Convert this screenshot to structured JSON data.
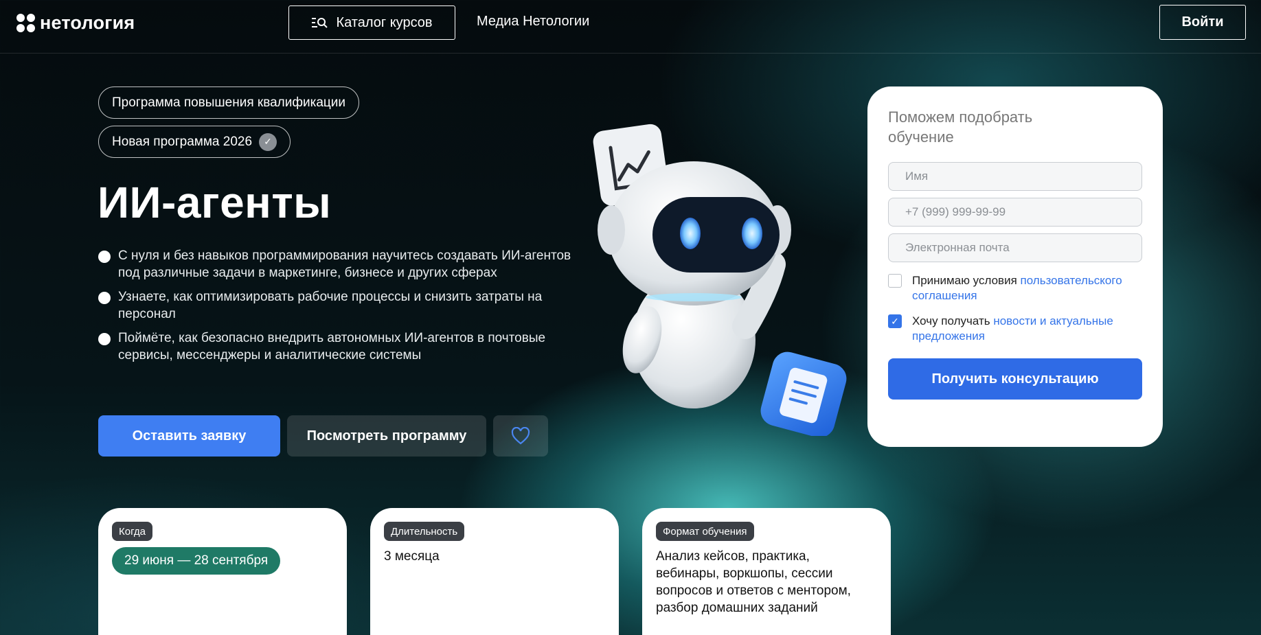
{
  "header": {
    "logo_text": "нетология",
    "catalog_label": "Каталог курсов",
    "media_label": "Медиа Нетологии",
    "login_label": "Войти"
  },
  "hero": {
    "badge_program": "Программа повышения квалификации",
    "badge_new": "Новая программа 2026",
    "title": "ИИ-агенты",
    "bullets": [
      "С нуля и без навыков программирования научитесь создавать ИИ-агентов под различные задачи в маркетинге, бизнесе и других сферах",
      "Узнаете, как оптимизировать рабочие процессы и снизить затраты на персонал",
      "Поймёте, как безопасно внедрить автономных ИИ-агентов в почтовые сервисы, мессенджеры и аналитические системы"
    ],
    "apply_label": "Оставить заявку",
    "program_label": "Посмотреть программу"
  },
  "form": {
    "title": "Поможем подобрать обучение",
    "name_placeholder": "Имя",
    "phone_placeholder": "+7 (999) 999-99-99",
    "email_placeholder": "Электронная почта",
    "terms_text": "Принимаю условия ",
    "terms_link": "пользовательского соглашения",
    "terms_checked": false,
    "news_text": "Хочу получать ",
    "news_link": "новости и актуальные предложения",
    "news_checked": true,
    "submit_label": "Получить консультацию"
  },
  "info": {
    "when_tag": "Когда",
    "when_value": "29 июня — 28 сентября",
    "duration_tag": "Длительность",
    "duration_value": "3 месяца",
    "format_tag": "Формат обучения",
    "format_value": "Анализ кейсов, практика, вебинары, воркшопы, сессии вопросов и ответов с ментором, разбор домашних заданий"
  },
  "colors": {
    "primary_blue": "#3f7ef2",
    "link_blue": "#3474e8",
    "date_green": "#1f7a66"
  },
  "icons": {
    "catalog": "search-list-icon",
    "favorite": "heart-icon",
    "verified": "check-badge-icon",
    "checkbox_checked": "check-icon"
  }
}
